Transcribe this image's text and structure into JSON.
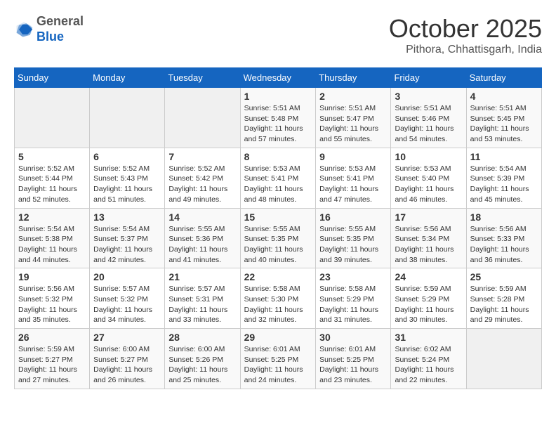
{
  "header": {
    "logo_general": "General",
    "logo_blue": "Blue",
    "month": "October 2025",
    "location": "Pithora, Chhattisgarh, India"
  },
  "weekdays": [
    "Sunday",
    "Monday",
    "Tuesday",
    "Wednesday",
    "Thursday",
    "Friday",
    "Saturday"
  ],
  "weeks": [
    [
      {
        "day": "",
        "info": ""
      },
      {
        "day": "",
        "info": ""
      },
      {
        "day": "",
        "info": ""
      },
      {
        "day": "1",
        "info": "Sunrise: 5:51 AM\nSunset: 5:48 PM\nDaylight: 11 hours\nand 57 minutes."
      },
      {
        "day": "2",
        "info": "Sunrise: 5:51 AM\nSunset: 5:47 PM\nDaylight: 11 hours\nand 55 minutes."
      },
      {
        "day": "3",
        "info": "Sunrise: 5:51 AM\nSunset: 5:46 PM\nDaylight: 11 hours\nand 54 minutes."
      },
      {
        "day": "4",
        "info": "Sunrise: 5:51 AM\nSunset: 5:45 PM\nDaylight: 11 hours\nand 53 minutes."
      }
    ],
    [
      {
        "day": "5",
        "info": "Sunrise: 5:52 AM\nSunset: 5:44 PM\nDaylight: 11 hours\nand 52 minutes."
      },
      {
        "day": "6",
        "info": "Sunrise: 5:52 AM\nSunset: 5:43 PM\nDaylight: 11 hours\nand 51 minutes."
      },
      {
        "day": "7",
        "info": "Sunrise: 5:52 AM\nSunset: 5:42 PM\nDaylight: 11 hours\nand 49 minutes."
      },
      {
        "day": "8",
        "info": "Sunrise: 5:53 AM\nSunset: 5:41 PM\nDaylight: 11 hours\nand 48 minutes."
      },
      {
        "day": "9",
        "info": "Sunrise: 5:53 AM\nSunset: 5:41 PM\nDaylight: 11 hours\nand 47 minutes."
      },
      {
        "day": "10",
        "info": "Sunrise: 5:53 AM\nSunset: 5:40 PM\nDaylight: 11 hours\nand 46 minutes."
      },
      {
        "day": "11",
        "info": "Sunrise: 5:54 AM\nSunset: 5:39 PM\nDaylight: 11 hours\nand 45 minutes."
      }
    ],
    [
      {
        "day": "12",
        "info": "Sunrise: 5:54 AM\nSunset: 5:38 PM\nDaylight: 11 hours\nand 44 minutes."
      },
      {
        "day": "13",
        "info": "Sunrise: 5:54 AM\nSunset: 5:37 PM\nDaylight: 11 hours\nand 42 minutes."
      },
      {
        "day": "14",
        "info": "Sunrise: 5:55 AM\nSunset: 5:36 PM\nDaylight: 11 hours\nand 41 minutes."
      },
      {
        "day": "15",
        "info": "Sunrise: 5:55 AM\nSunset: 5:35 PM\nDaylight: 11 hours\nand 40 minutes."
      },
      {
        "day": "16",
        "info": "Sunrise: 5:55 AM\nSunset: 5:35 PM\nDaylight: 11 hours\nand 39 minutes."
      },
      {
        "day": "17",
        "info": "Sunrise: 5:56 AM\nSunset: 5:34 PM\nDaylight: 11 hours\nand 38 minutes."
      },
      {
        "day": "18",
        "info": "Sunrise: 5:56 AM\nSunset: 5:33 PM\nDaylight: 11 hours\nand 36 minutes."
      }
    ],
    [
      {
        "day": "19",
        "info": "Sunrise: 5:56 AM\nSunset: 5:32 PM\nDaylight: 11 hours\nand 35 minutes."
      },
      {
        "day": "20",
        "info": "Sunrise: 5:57 AM\nSunset: 5:32 PM\nDaylight: 11 hours\nand 34 minutes."
      },
      {
        "day": "21",
        "info": "Sunrise: 5:57 AM\nSunset: 5:31 PM\nDaylight: 11 hours\nand 33 minutes."
      },
      {
        "day": "22",
        "info": "Sunrise: 5:58 AM\nSunset: 5:30 PM\nDaylight: 11 hours\nand 32 minutes."
      },
      {
        "day": "23",
        "info": "Sunrise: 5:58 AM\nSunset: 5:29 PM\nDaylight: 11 hours\nand 31 minutes."
      },
      {
        "day": "24",
        "info": "Sunrise: 5:59 AM\nSunset: 5:29 PM\nDaylight: 11 hours\nand 30 minutes."
      },
      {
        "day": "25",
        "info": "Sunrise: 5:59 AM\nSunset: 5:28 PM\nDaylight: 11 hours\nand 29 minutes."
      }
    ],
    [
      {
        "day": "26",
        "info": "Sunrise: 5:59 AM\nSunset: 5:27 PM\nDaylight: 11 hours\nand 27 minutes."
      },
      {
        "day": "27",
        "info": "Sunrise: 6:00 AM\nSunset: 5:27 PM\nDaylight: 11 hours\nand 26 minutes."
      },
      {
        "day": "28",
        "info": "Sunrise: 6:00 AM\nSunset: 5:26 PM\nDaylight: 11 hours\nand 25 minutes."
      },
      {
        "day": "29",
        "info": "Sunrise: 6:01 AM\nSunset: 5:25 PM\nDaylight: 11 hours\nand 24 minutes."
      },
      {
        "day": "30",
        "info": "Sunrise: 6:01 AM\nSunset: 5:25 PM\nDaylight: 11 hours\nand 23 minutes."
      },
      {
        "day": "31",
        "info": "Sunrise: 6:02 AM\nSunset: 5:24 PM\nDaylight: 11 hours\nand 22 minutes."
      },
      {
        "day": "",
        "info": ""
      }
    ]
  ]
}
